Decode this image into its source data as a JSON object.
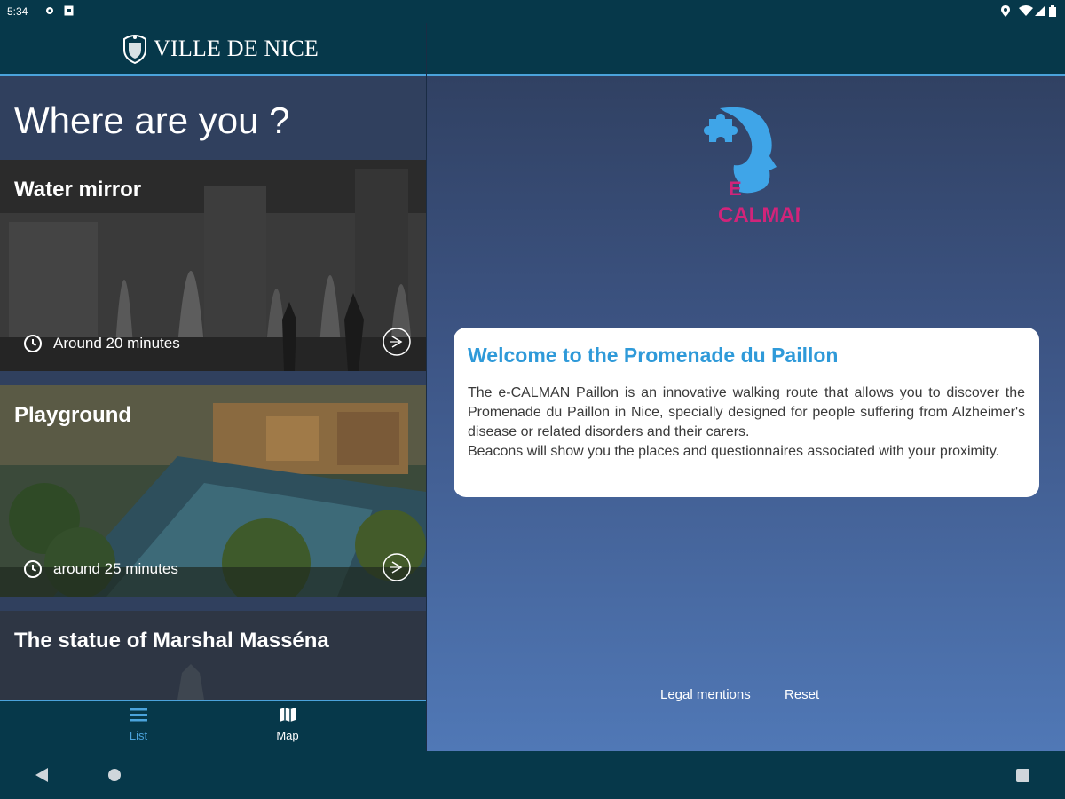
{
  "status_bar": {
    "time": "5:34"
  },
  "header": {
    "brand": "VILLE DE NICE"
  },
  "left": {
    "page_title": "Where are you ?",
    "cards": [
      {
        "title": "Water mirror",
        "duration": "Around 20 minutes"
      },
      {
        "title": "Playground",
        "duration": "around 25 minutes"
      },
      {
        "title": "The statue of Marshal Masséna"
      }
    ],
    "nav": {
      "list_label": "List",
      "map_label": "Map"
    }
  },
  "right": {
    "welcome": {
      "title": "Welcome to the Promenade du Paillon",
      "paragraph_1": "The e-CALMAN Paillon is an innovative walking route that allows you to discover the Promenade du Paillon in Nice, specially designed for people suffering from Alzheimer's disease or related disorders and their carers.",
      "paragraph_2": "Beacons will show you the places and questionnaires associated with your proximity."
    },
    "logo_text": {
      "line1": "E",
      "line2": "CALMAN"
    },
    "footer": {
      "legal": "Legal mentions",
      "reset": "Reset"
    }
  },
  "colors": {
    "accent": "#4ba3dc",
    "bar": "#06384a",
    "welcome_title": "#2f9ad9",
    "logo_pink": "#d1247a"
  },
  "icons": [
    "settings-icon",
    "sim-icon",
    "location-icon",
    "wifi-icon",
    "signal-icon",
    "battery-icon",
    "clock-icon",
    "arrow-circle-icon",
    "list-icon",
    "map-icon",
    "back-icon",
    "home-icon",
    "recents-icon"
  ]
}
